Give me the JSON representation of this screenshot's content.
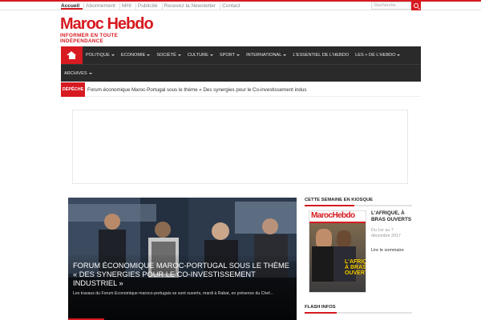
{
  "topbar": {
    "links": [
      "Accueil",
      "Abonnement",
      "MHI",
      "Publicité",
      "Recevez la Newsletter",
      "Contact"
    ],
    "search_placeholder": "Recherche"
  },
  "logo": {
    "name": "Maroc Hebdo",
    "tagline": "INFORMER EN TOUTE INDÉPENDANCE"
  },
  "nav": {
    "row1": [
      "POLITIQUE",
      "ECONOMIE",
      "SOCIÉTÉ",
      "CULTURE",
      "SPORT",
      "INTERNATIONAL",
      "L'ESSENTIEL DE L'HEBDO",
      "LES + DE L'HEBDO"
    ],
    "row2": [
      "ARCHIVES"
    ]
  },
  "ticker": {
    "label": "DÉPÊCHE",
    "text": "Forum économique Maroc-Portugal sous le thème « Des synergies pour le Co-investissement indus"
  },
  "hero": {
    "title": "Forum économique Maroc-Portugal sous le thème « Des synergies pour le Co-investissement industriel »",
    "excerpt": "Les travaux du Forum Economique maroco-portugais se sont ouverts, mardi à Rabat, en présence du Chef..."
  },
  "sidebar": {
    "kiosque_title": "CETTE SEMAINE EN KIOSQUE",
    "cover_mast": "MarocHebdo",
    "cover_headline": "L'AFRIQUE, À BRAS OUVERTS",
    "issue_title": "L'AFRIQUE, À BRAS OUVERTS",
    "issue_dates": "Du 1er au 7 décembre 2017",
    "summary_link": "Lire le sommaire",
    "flash_title": "FLASH INFOS"
  },
  "colors": {
    "accent": "#d71920",
    "nav_bg": "#2a2a2a"
  }
}
